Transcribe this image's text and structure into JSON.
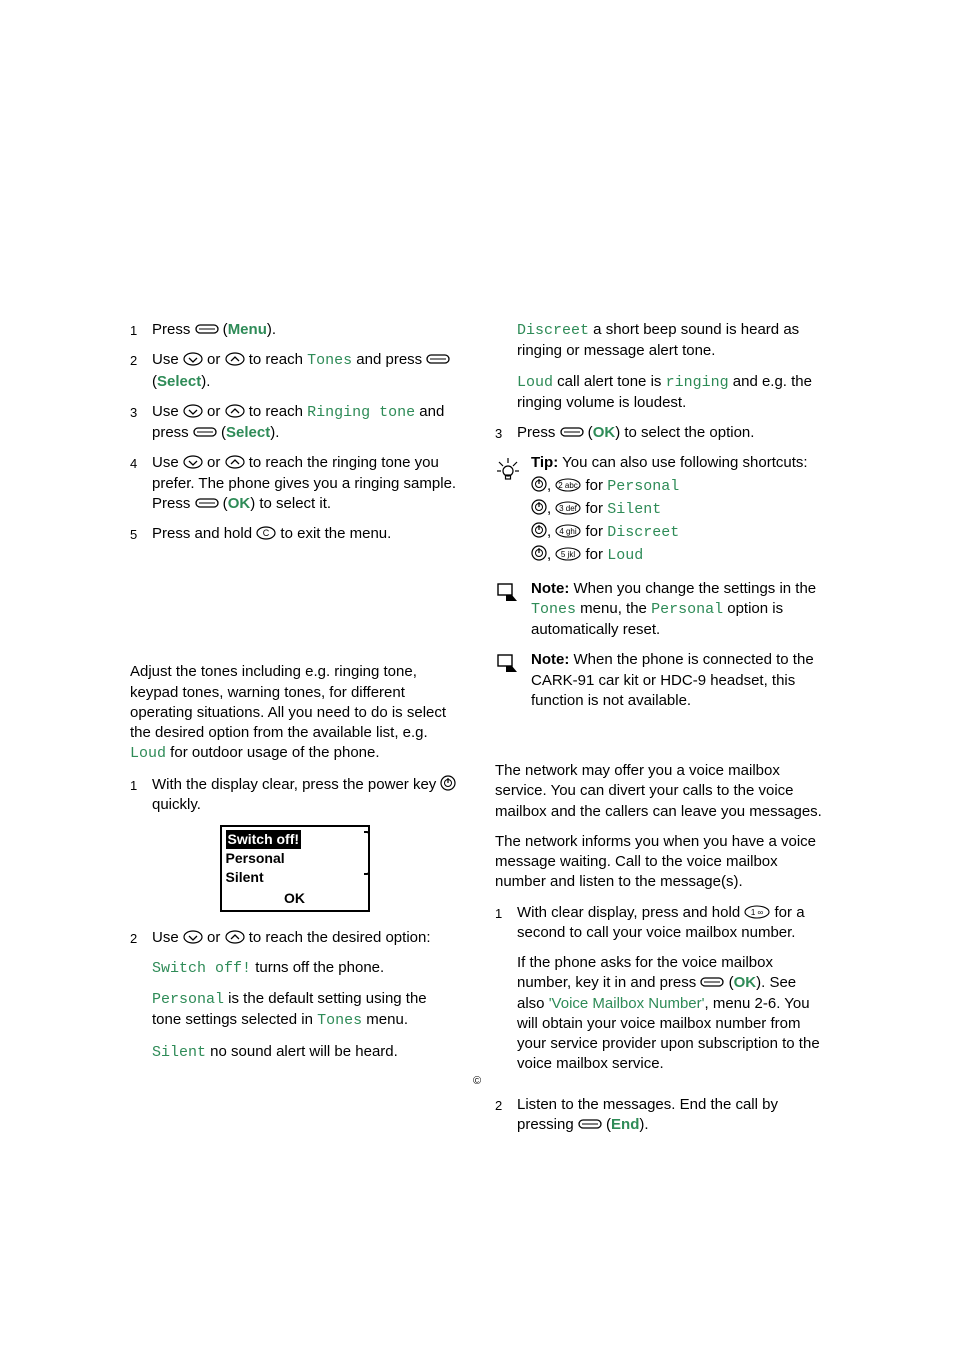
{
  "left": {
    "step1": {
      "num": "1",
      "a": "Press",
      "menu": "Menu",
      "b": ")."
    },
    "step2": {
      "num": "2",
      "a": "Use",
      "b": "or",
      "c": "to reach",
      "tones": "Tones",
      "d": "and press",
      "select": "Select",
      "e": ")."
    },
    "step3": {
      "num": "3",
      "a": "Use",
      "b": "or",
      "c": "to reach",
      "ringtone": "Ringing tone",
      "d": "and press",
      "select": "Select",
      "e": ")."
    },
    "step4": {
      "num": "4",
      "a": "Use",
      "b": "or",
      "c": "to reach the ringing tone you prefer. The phone gives you a ringing sample. Press",
      "ok": "OK",
      "d": ") to select it."
    },
    "step5": {
      "num": "5",
      "a": "Press and hold",
      "b": "to exit the menu."
    },
    "intro": {
      "a": "Adjust the tones including e.g. ringing tone, keypad tones, warning tones, for different operating situations. All you need to do is select the desired option from the available list, e.g. ",
      "loud": "Loud",
      "b": " for outdoor usage of the phone."
    },
    "pstep1": {
      "num": "1",
      "a": "With the display clear, press the power key",
      "b": "quickly."
    },
    "screen": {
      "l1": "Switch off!",
      "l2": "Personal",
      "l3": "Silent",
      "ok": "OK"
    },
    "pstep2": {
      "num": "2",
      "a": "Use",
      "b": "or",
      "c": "to reach the desired option:",
      "opt1a": "Switch off!",
      "opt1b": " turns off the phone.",
      "opt2a": "Personal",
      "opt2b": " is the default setting using the tone settings selected in ",
      "opt2c": "Tones",
      "opt2d": " menu.",
      "opt3a": "Silent",
      "opt3b": " no sound alert will be heard."
    }
  },
  "right": {
    "discreet": {
      "a": "Discreet",
      "b": " a short beep sound is heard as ringing or message alert tone."
    },
    "loud": {
      "a": "Loud",
      "b": " call alert tone is ",
      "c": "ringing",
      "d": " and e.g. the ringing volume is loudest."
    },
    "step3": {
      "num": "3",
      "a": "Press",
      "ok": "OK",
      "b": ") to select the option."
    },
    "tip": {
      "a": "Tip:",
      "b": " You can also use following shortcuts:",
      "s1": " for ",
      "s1v": "Personal",
      "s2": " for ",
      "s2v": "Silent",
      "s3": " for ",
      "s3v": "Discreet",
      "s4": " for ",
      "s4v": "Loud"
    },
    "note1": {
      "a": "Note:",
      "b": " When you change the settings in the ",
      "c": "Tones",
      "d": " menu, the ",
      "e": "Personal",
      "f": " option is automatically reset."
    },
    "note2": {
      "a": "Note:",
      "b": " When the phone is connected to the CARK-91 car kit or HDC-9 headset, this function is not available."
    },
    "vm_p1": "The network may offer you a voice mailbox service. You can divert your calls to the voice mailbox and the callers can leave you messages.",
    "vm_p2": "The network informs you when you have a voice message waiting. Call to the voice mailbox number and listen to the message(s).",
    "vstep1": {
      "num": "1",
      "a": "With clear display, press and hold",
      "b": "for a second to call your voice mailbox number.",
      "c": "If the phone asks for the voice mailbox number, key it in and press",
      "ok": "OK",
      "d": "). See also ",
      "ref": "'Voice Mailbox Number'",
      "e": ", menu 2-6. You will obtain your voice mailbox number from your service provider upon subscription to the voice mailbox service."
    },
    "vstep2": {
      "num": "2",
      "a": "Listen to the messages. End the call by pressing",
      "end": "End",
      "b": ")."
    }
  },
  "footer": "©"
}
